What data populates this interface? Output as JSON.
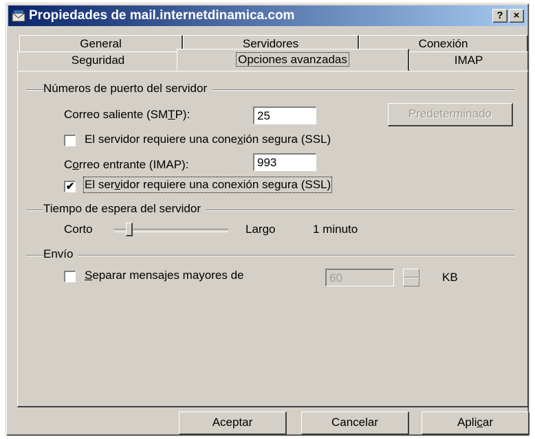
{
  "window": {
    "title": "Propiedades de mail.internetdinamica.com",
    "help_label": "?",
    "close_label": "×"
  },
  "tabs": {
    "row1": [
      "General",
      "Servidores",
      "Conexión"
    ],
    "row2": [
      "Seguridad",
      "Opciones avanzadas",
      "IMAP"
    ],
    "active": "Opciones avanzadas"
  },
  "ports": {
    "group_label": "Números de puerto del servidor",
    "smtp_label_pre": "Correo saliente (SM",
    "smtp_label_ul": "T",
    "smtp_label_post": "P):",
    "smtp_value": "25",
    "default_button": "Predeterminado",
    "smtp_ssl_label_pre": "El servidor requiere una cone",
    "smtp_ssl_label_ul": "x",
    "smtp_ssl_label_post": "ión segura (SSL)",
    "smtp_ssl_checked": false,
    "imap_label_pre": "C",
    "imap_label_ul": "o",
    "imap_label_post": "rreo entrante (IMAP):",
    "imap_value": "993",
    "imap_ssl_label_pre": "El ser",
    "imap_ssl_label_ul": "v",
    "imap_ssl_label_post": "idor requiere una conexión segura (SSL)",
    "imap_ssl_checked": true,
    "check_mark": "✔"
  },
  "timeout": {
    "group_label": "Tiempo de espera del servidor",
    "short_label": "Corto",
    "long_label": "Largo",
    "value_text": "1 minuto"
  },
  "sending": {
    "group_label": "Envío",
    "split_label_ul": "S",
    "split_label_post": "eparar mensajes mayores de",
    "split_checked": false,
    "split_value": "60",
    "unit": "KB"
  },
  "buttons": {
    "ok": "Aceptar",
    "cancel": "Cancelar",
    "apply_pre": "Apli",
    "apply_ul": "c",
    "apply_post": "ar"
  }
}
